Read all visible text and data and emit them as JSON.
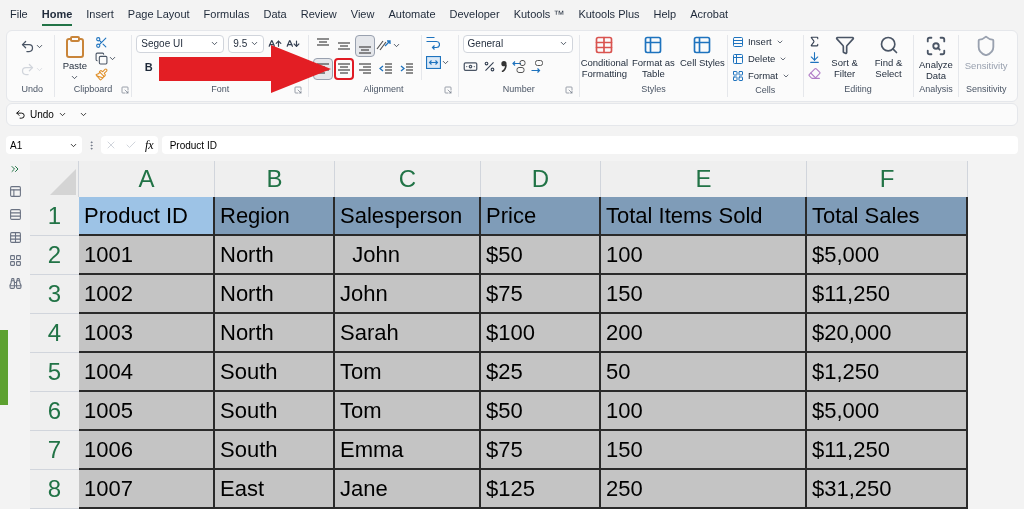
{
  "menu_tabs": [
    {
      "label": "File",
      "selected": false
    },
    {
      "label": "Home",
      "selected": true
    },
    {
      "label": "Insert",
      "selected": false
    },
    {
      "label": "Page Layout",
      "selected": false
    },
    {
      "label": "Formulas",
      "selected": false
    },
    {
      "label": "Data",
      "selected": false
    },
    {
      "label": "Review",
      "selected": false
    },
    {
      "label": "View",
      "selected": false
    },
    {
      "label": "Automate",
      "selected": false
    },
    {
      "label": "Developer",
      "selected": false
    },
    {
      "label": "Kutools ™",
      "selected": false
    },
    {
      "label": "Kutools Plus",
      "selected": false
    },
    {
      "label": "Help",
      "selected": false
    },
    {
      "label": "Acrobat",
      "selected": false
    }
  ],
  "ribbon": {
    "undo": {
      "label": "Undo"
    },
    "clipboard": {
      "label": "Clipboard",
      "paste": "Paste"
    },
    "font": {
      "label": "Font",
      "font_name": "Segoe UI",
      "font_size": "9.5",
      "bold": "B"
    },
    "alignment": {
      "label": "Alignment",
      "buttons": [
        {
          "kind": "align-top",
          "selected": false,
          "highlighted": false
        },
        {
          "kind": "align-middle",
          "selected": false,
          "highlighted": false
        },
        {
          "kind": "align-bottom",
          "selected": true,
          "highlighted": false
        },
        {
          "kind": "align-left",
          "selected": true,
          "highlighted": false
        },
        {
          "kind": "align-center",
          "selected": false,
          "highlighted": true
        },
        {
          "kind": "align-right",
          "selected": false,
          "highlighted": false
        },
        {
          "kind": "indent-decrease",
          "selected": false,
          "highlighted": false
        },
        {
          "kind": "indent-increase",
          "selected": false,
          "highlighted": false
        }
      ]
    },
    "number": {
      "label": "Number",
      "format": "General"
    },
    "styles": {
      "label": "Styles",
      "buttons": [
        "Conditional Formatting",
        "Format as Table",
        "Cell Styles"
      ]
    },
    "cells": {
      "label": "Cells",
      "buttons": [
        "Insert",
        "Delete",
        "Format"
      ]
    },
    "editing": {
      "label": "Editing",
      "buttons": [
        "Sort & Filter",
        "Find & Select"
      ]
    },
    "analysis": {
      "label": "Analysis",
      "button": "Analyze Data"
    },
    "sensitivity": {
      "label": "Sensitivity",
      "button": "Sensitivity",
      "disabled": true
    }
  },
  "quick_access": {
    "undo": "Undo"
  },
  "formula_bar": {
    "name_box": "A1",
    "fx": "fx",
    "formula": "Product ID"
  },
  "sheet": {
    "columns": [
      "A",
      "B",
      "C",
      "D",
      "E",
      "F"
    ],
    "rows": [
      {
        "number": "1",
        "kind": "header",
        "cells": [
          {
            "text": "Product ID",
            "selected": true
          },
          {
            "text": "Region",
            "selected": false
          },
          {
            "text": "Salesperson",
            "selected": false
          },
          {
            "text": "Price",
            "selected": false
          },
          {
            "text": "Total Items Sold",
            "selected": false
          },
          {
            "text": "Total Sales",
            "selected": false
          }
        ]
      },
      {
        "number": "2",
        "kind": "data",
        "cells": [
          {
            "text": "1001",
            "selected": false
          },
          {
            "text": "North",
            "selected": false
          },
          {
            "text": "  John",
            "selected": false
          },
          {
            "text": "$50",
            "selected": false
          },
          {
            "text": "100",
            "selected": false
          },
          {
            "text": "$5,000",
            "selected": false
          }
        ]
      },
      {
        "number": "3",
        "kind": "data",
        "cells": [
          {
            "text": "1002",
            "selected": false
          },
          {
            "text": "North",
            "selected": false
          },
          {
            "text": "John",
            "selected": false
          },
          {
            "text": "$75",
            "selected": false
          },
          {
            "text": "150",
            "selected": false
          },
          {
            "text": "$11,250",
            "selected": false
          }
        ]
      },
      {
        "number": "4",
        "kind": "data",
        "cells": [
          {
            "text": "1003",
            "selected": false
          },
          {
            "text": "North",
            "selected": false
          },
          {
            "text": "Sarah",
            "selected": false
          },
          {
            "text": "$100",
            "selected": false
          },
          {
            "text": "200",
            "selected": false
          },
          {
            "text": "$20,000",
            "selected": false
          }
        ]
      },
      {
        "number": "5",
        "kind": "data",
        "cells": [
          {
            "text": "1004",
            "selected": false
          },
          {
            "text": "South",
            "selected": false
          },
          {
            "text": "Tom",
            "selected": false
          },
          {
            "text": "$25",
            "selected": false
          },
          {
            "text": "50",
            "selected": false
          },
          {
            "text": "$1,250",
            "selected": false
          }
        ]
      },
      {
        "number": "6",
        "kind": "data",
        "cells": [
          {
            "text": "1005",
            "selected": false
          },
          {
            "text": "South",
            "selected": false
          },
          {
            "text": "Tom",
            "selected": false
          },
          {
            "text": "$50",
            "selected": false
          },
          {
            "text": "100",
            "selected": false
          },
          {
            "text": "$5,000",
            "selected": false
          }
        ]
      },
      {
        "number": "7",
        "kind": "data",
        "cells": [
          {
            "text": "1006",
            "selected": false
          },
          {
            "text": "South",
            "selected": false
          },
          {
            "text": "Emma",
            "selected": false
          },
          {
            "text": "$75",
            "selected": false
          },
          {
            "text": "150",
            "selected": false
          },
          {
            "text": "$11,250",
            "selected": false
          }
        ]
      },
      {
        "number": "8",
        "kind": "data",
        "cells": [
          {
            "text": "1007",
            "selected": false
          },
          {
            "text": "East",
            "selected": false
          },
          {
            "text": "Jane",
            "selected": false
          },
          {
            "text": "$125",
            "selected": false
          },
          {
            "text": "250",
            "selected": false
          },
          {
            "text": "$31,250",
            "selected": false
          }
        ]
      }
    ]
  }
}
